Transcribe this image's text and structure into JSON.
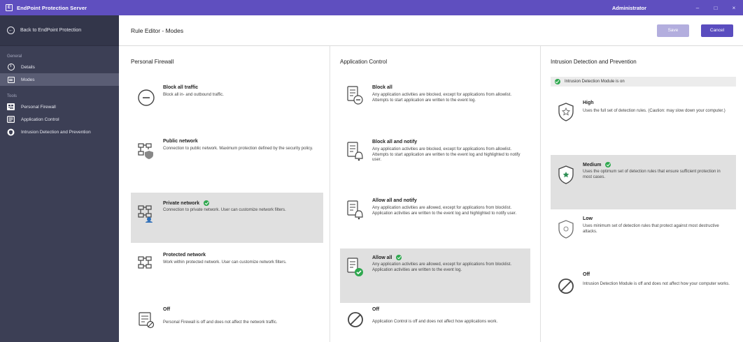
{
  "titlebar": {
    "app_icon": "app-logo-icon",
    "app_title": "EndPoint Protection Server",
    "user": "Administrator",
    "minimize_glyph": "–",
    "maximize_glyph": "□",
    "close_glyph": "×"
  },
  "sidebar": {
    "back_label": "Back to EndPoint Protection",
    "back_icon": "back-arrow-icon",
    "general_label": "General",
    "general_items": [
      {
        "label": "Details",
        "icon": "info-icon",
        "active": false
      },
      {
        "label": "Modes",
        "icon": "modes-icon",
        "active": true
      }
    ],
    "tools_label": "Tools",
    "tools_items": [
      {
        "label": "Personal Firewall",
        "icon": "firewall-icon"
      },
      {
        "label": "Application Control",
        "icon": "application-control-icon"
      },
      {
        "label": "Intrusion Detection and Prevention",
        "icon": "shield-icon"
      }
    ]
  },
  "header": {
    "title": "Rule Editor - Modes",
    "save_label": "Save",
    "cancel_label": "Cancel"
  },
  "columns": {
    "firewall": {
      "title": "Personal Firewall",
      "options": [
        {
          "title": "Block all traffic",
          "desc": "Block all in- and outbound traffic.",
          "selected": false,
          "icon": "block-traffic-icon"
        },
        {
          "title": "Public network",
          "desc": "Connection to public network. Maximum protection defined by the security policy.",
          "selected": false,
          "icon": "public-network-icon"
        },
        {
          "title": "Private network",
          "desc": "Connection to private network. User can customize network filters.",
          "selected": true,
          "icon": "private-network-icon"
        },
        {
          "title": "Protected network",
          "desc": "Work within protected network. User can customize network filters.",
          "selected": false,
          "icon": "protected-network-icon"
        },
        {
          "title": "Off",
          "desc": "Personal Firewall is off and does not affect the network traffic.",
          "selected": false,
          "icon": "firewall-off-icon"
        }
      ]
    },
    "appcontrol": {
      "title": "Application Control",
      "options": [
        {
          "title": "Block all",
          "desc": "Any application activities are blocked, except for applications from allowlist. Attempts to start application are written to the event log.",
          "selected": false,
          "icon": "block-all-icon"
        },
        {
          "title": "Block all and notify",
          "desc": "Any application activities are blocked, except for applications from allowlist. Attempts to start application are written to the event log and highlighted to notify user.",
          "selected": false,
          "icon": "block-notify-icon"
        },
        {
          "title": "Allow all and notify",
          "desc": "Any application activities are allowed, except for applications from blocklist. Application activities are written to the event log and highlighted to notify user.",
          "selected": false,
          "icon": "allow-notify-icon"
        },
        {
          "title": "Allow all",
          "desc": "Any application activities are allowed, except for applications from blocklist. Application activities are written to the event log.",
          "selected": true,
          "icon": "allow-all-icon"
        },
        {
          "title": "Off",
          "desc": "Application Control is off and does not affect how applications work.",
          "selected": false,
          "icon": "off-icon"
        }
      ]
    },
    "intrusion": {
      "title": "Intrusion Detection and Prevention",
      "status": "Intrusion Detection Module is on",
      "options": [
        {
          "title": "High",
          "desc": "Uses the full set of detection rules. (Caution: may slow down your computer.)",
          "selected": false,
          "icon": "shield-high-icon"
        },
        {
          "title": "Medium",
          "desc": "Uses the optimum set of detection rules that ensure sufficient protection in most cases.",
          "selected": true,
          "icon": "shield-medium-icon"
        },
        {
          "title": "Low",
          "desc": "Uses minimum set of detection rules that protect against most destructive attacks.",
          "selected": false,
          "icon": "shield-low-icon"
        },
        {
          "title": "Off",
          "desc": "Intrusion Detection Module is off and does not affect how your computer works.",
          "selected": false,
          "icon": "off-icon"
        }
      ]
    }
  },
  "colors": {
    "titlebar": "#5f4fbf",
    "sidebar": "#3c3f55",
    "accent": "#5a4dbf",
    "selected_bg": "#e0e0e0",
    "check": "#2fa84f"
  }
}
